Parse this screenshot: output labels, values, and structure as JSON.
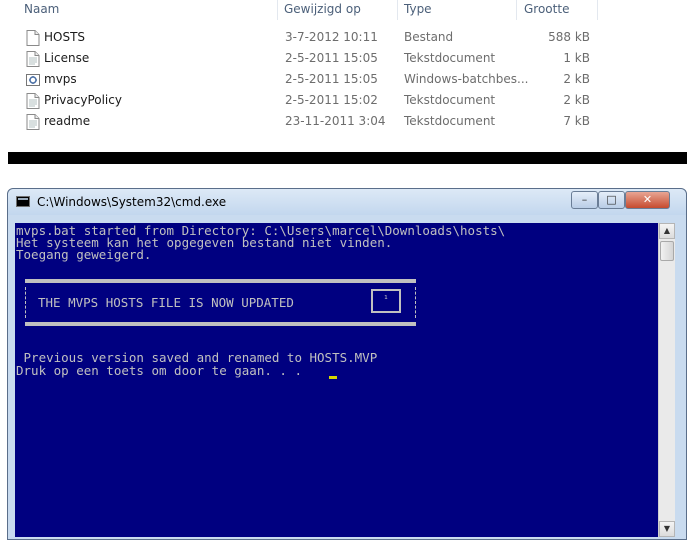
{
  "explorer": {
    "columns": {
      "name": "Naam",
      "modified": "Gewijzigd op",
      "type": "Type",
      "size": "Grootte"
    },
    "files": [
      {
        "name": "HOSTS",
        "date": "3-7-2012 10:11",
        "type": "Bestand",
        "size": "588 kB",
        "icon": "blank-file-icon"
      },
      {
        "name": "License",
        "date": "2-5-2011 15:05",
        "type": "Tekstdocument",
        "size": "1 kB",
        "icon": "text-file-icon"
      },
      {
        "name": "mvps",
        "date": "2-5-2011 15:05",
        "type": "Windows-batchbes...",
        "size": "2 kB",
        "icon": "batch-file-icon"
      },
      {
        "name": "PrivacyPolicy",
        "date": "2-5-2011 15:02",
        "type": "Tekstdocument",
        "size": "2 kB",
        "icon": "text-file-icon"
      },
      {
        "name": "readme",
        "date": "23-11-2011 3:04",
        "type": "Tekstdocument",
        "size": "7 kB",
        "icon": "text-file-icon"
      }
    ]
  },
  "cmd": {
    "title": "C:\\Windows\\System32\\cmd.exe",
    "buttons": {
      "minimize": "–",
      "maximize": "□",
      "close": "✕"
    },
    "lines": [
      "mvps.bat started from Directory: C:\\Users\\marcel\\Downloads\\hosts\\",
      "Het systeem kan het opgegeven bestand niet vinden.",
      "Toegang geweigerd."
    ],
    "banner": "THE MVPS HOSTS FILE IS NOW UPDATED",
    "banner_mini": "¹",
    "after_lines": [
      " Previous version saved and renamed to HOSTS.MVP",
      "Druk op een toets om door te gaan. . ."
    ],
    "scroll": {
      "up": "▲",
      "down": "▼"
    },
    "colors": {
      "console_bg": "#000080",
      "console_fg": "#c0c0c0",
      "cursor": "#d8d800"
    }
  }
}
